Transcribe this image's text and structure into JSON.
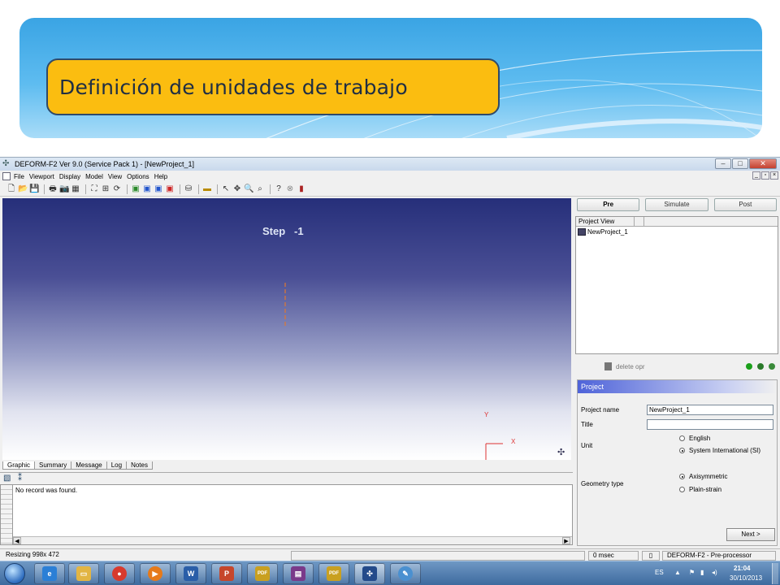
{
  "slide": {
    "title": "Definición de unidades de trabajo"
  },
  "window": {
    "title": "DEFORM-F2  Ver 9.0 (Service Pack 1)  - [NewProject_1]",
    "menu": [
      "File",
      "Viewport",
      "Display",
      "Model",
      "View",
      "Options",
      "Help"
    ]
  },
  "viewport": {
    "step_label": "Step",
    "step_value": "-1",
    "axis_y": "Y",
    "axis_x": "X"
  },
  "tabs": [
    "Graphic",
    "Summary",
    "Message",
    "Log",
    "Notes"
  ],
  "messages": {
    "text": "No record was found."
  },
  "status": {
    "left": "Resizing  998x 472",
    "time": "0 msec",
    "mode": "DEFORM-F2  -  Pre-processor"
  },
  "right_tabs": [
    "Pre",
    "Simulate",
    "Post"
  ],
  "project_tree": {
    "header": "Project View",
    "node": "NewProject_1"
  },
  "operations": {
    "delete_label": "delete opr"
  },
  "project_panel": {
    "header": "Project",
    "project_name_label": "Project name",
    "project_name_value": "NewProject_1",
    "title_label": "Title",
    "title_value": "",
    "unit_label": "Unit",
    "unit_options": [
      "English",
      "System International (SI)"
    ],
    "unit_selected": "System International (SI)",
    "geometry_label": "Geometry type",
    "geometry_options": [
      "Axisymmetric",
      "Plain-strain"
    ],
    "geometry_selected": "Axisymmetric",
    "next_label": "Next >"
  },
  "taskbar": {
    "apps": [
      "IE",
      "Explorer",
      "Chrome",
      "Media Player",
      "Word",
      "PowerPoint",
      "PDF",
      "WinRAR",
      "PDF",
      "DEFORM",
      "Paint"
    ],
    "lang": "ES",
    "time": "21:04",
    "date": "30/10/2013"
  },
  "colors": {
    "title_box": "#fbbd10",
    "banner": "#3aa4e4",
    "viewport_top": "#262f7a",
    "axis": "#dd3333"
  }
}
